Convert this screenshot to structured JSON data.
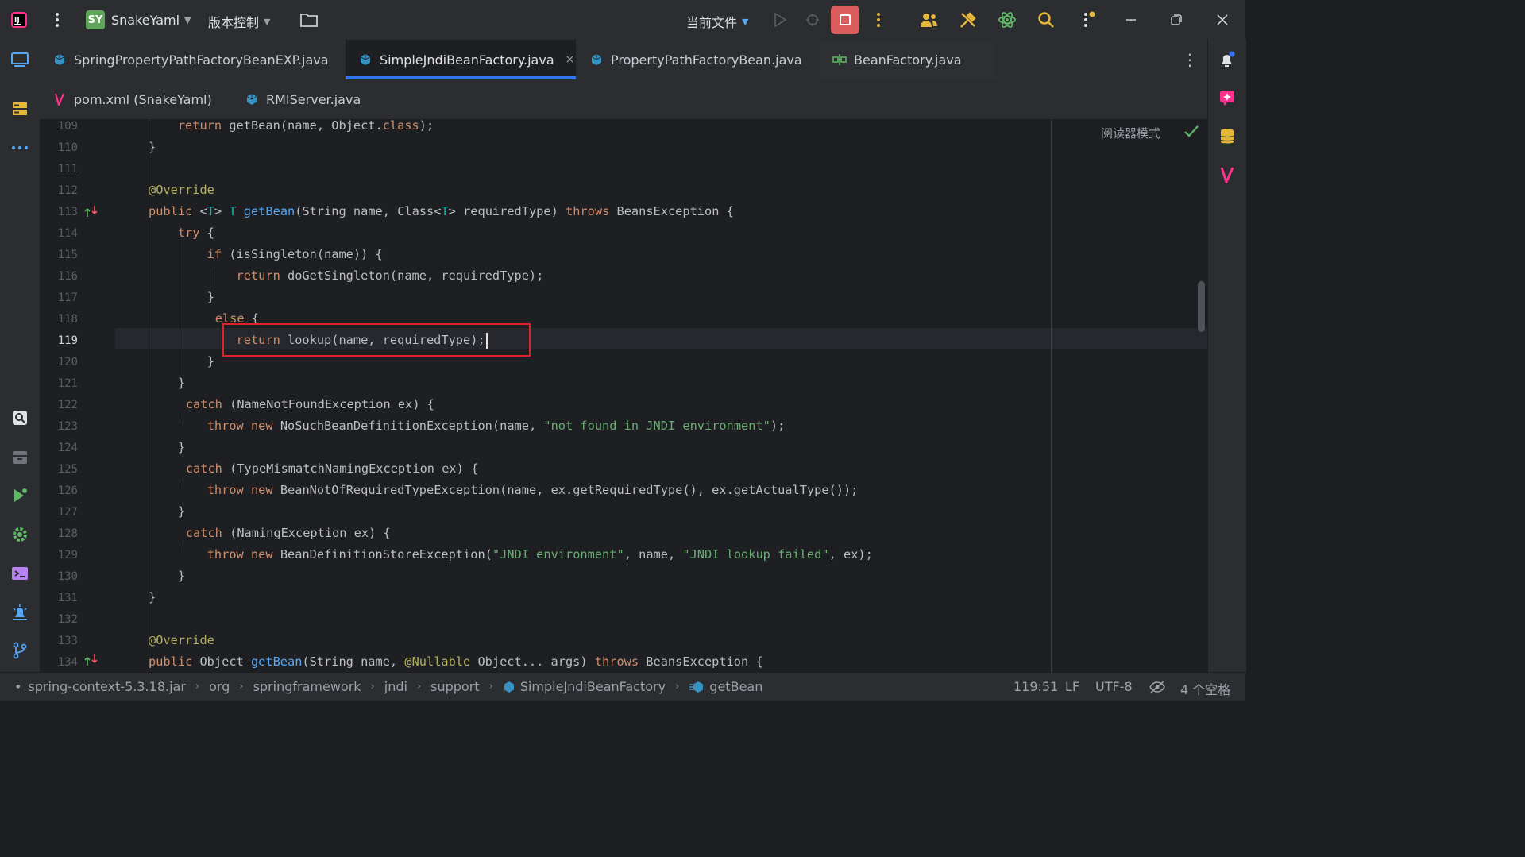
{
  "titlebar": {
    "project_badge": "SY",
    "project_name": "SnakeYaml",
    "vcs_label": "版本控制",
    "run_config": "当前文件",
    "icons": [
      "app-logo-icon",
      "main-menu-icon",
      "folder-icon",
      "run-icon",
      "debug-icon",
      "stop-icon",
      "more-actions-icon",
      "code-with-me-icon",
      "build-tools-icon",
      "ai-assistant-icon",
      "search-icon",
      "settings-updates-icon",
      "minimize-icon",
      "restore-icon",
      "close-icon"
    ]
  },
  "tabs_row1": [
    {
      "label": "SpringPropertyPathFactoryBeanEXP.java",
      "icon": "java-class-icon",
      "active": false
    },
    {
      "label": "SimpleJndiBeanFactory.java",
      "icon": "java-class-icon",
      "active": true
    },
    {
      "label": "PropertyPathFactoryBean.java",
      "icon": "java-class-icon",
      "active": false
    },
    {
      "label": "BeanFactory.java",
      "icon": "interface-icon",
      "active": false
    }
  ],
  "tabs_row2": [
    {
      "label": "pom.xml (SnakeYaml)",
      "icon": "maven-icon",
      "active": false
    },
    {
      "label": "RMIServer.java",
      "icon": "java-class-icon",
      "active": false
    }
  ],
  "tab_close_glyph": "×",
  "editor": {
    "reader_mode_label": "阅读器模式",
    "current_line": 119,
    "line_numbers": [
      "109",
      "110",
      "111",
      "112",
      "113",
      "114",
      "115",
      "116",
      "117",
      "118",
      "119",
      "120",
      "121",
      "122",
      "123",
      "124",
      "125",
      "126",
      "127",
      "128",
      "129",
      "130",
      "131",
      "132",
      "133",
      "134"
    ],
    "code": {
      "l109": {
        "kw1": "return",
        "rest": " getBean(name, Object.",
        "kw2": "class",
        "end": ");"
      },
      "l110": {
        "text": "}"
      },
      "l112": {
        "ann": "@Override"
      },
      "l113": {
        "kw1": "public",
        "lt": " <",
        "tp1": "T",
        "gt": "> ",
        "tp2": "T",
        "sp": " ",
        "fn": "getBean",
        "args1": "(String name, Class<",
        "tp3": "T",
        "args2": "> requiredType) ",
        "kw2": "throws",
        "rest": " BeansException {"
      },
      "l114": {
        "kw": "try",
        "rest": " {"
      },
      "l115": {
        "kw": "if",
        "rest": " (isSingleton(name)) {"
      },
      "l116": {
        "kw": "return",
        "rest": " doGetSingleton(name, requiredType);"
      },
      "l117": {
        "text": "}"
      },
      "l118": {
        "kw": "else",
        "rest": " {"
      },
      "l119": {
        "kw": "return",
        "rest": " lookup(name, requiredType);"
      },
      "l120": {
        "text": "}"
      },
      "l121": {
        "text": "}"
      },
      "l122": {
        "kw": "catch",
        "rest": " (NameNotFoundException ex) {"
      },
      "l123": {
        "kw1": "throw",
        "sp": " ",
        "kw2": "new",
        "rest": " NoSuchBeanDefinitionException(name, ",
        "str": "\"not found in JNDI environment\"",
        "end": ");"
      },
      "l124": {
        "text": "}"
      },
      "l125": {
        "kw": "catch",
        "rest": " (TypeMismatchNamingException ex) {"
      },
      "l126": {
        "kw1": "throw",
        "sp": " ",
        "kw2": "new",
        "rest": " BeanNotOfRequiredTypeException(name, ex.getRequiredType(), ex.getActualType());"
      },
      "l127": {
        "text": "}"
      },
      "l128": {
        "kw": "catch",
        "rest": " (NamingException ex) {"
      },
      "l129": {
        "kw1": "throw",
        "sp": " ",
        "kw2": "new",
        "mid": " BeanDefinitionStoreException(",
        "str1": "\"JNDI environment\"",
        "mid2": ", name, ",
        "str2": "\"JNDI lookup failed\"",
        "end": ", ex);"
      },
      "l130": {
        "text": "}"
      },
      "l131": {
        "text": "}"
      },
      "l133": {
        "ann": "@Override"
      },
      "l134": {
        "kw1": "public",
        "rest1": " Object ",
        "fn": "getBean",
        "args1": "(String name, ",
        "ann": "@Nullable",
        "args2": " Object... args) ",
        "kw2": "throws",
        "rest": " BeansException {"
      }
    }
  },
  "statusbar": {
    "breadcrumbs": [
      "spring-context-5.3.18.jar",
      "org",
      "springframework",
      "jndi",
      "support",
      "SimpleJndiBeanFactory",
      "getBean"
    ],
    "breadcrumb_sep": "›",
    "position": "119:51",
    "line_separator": "LF",
    "encoding": "UTF-8",
    "indent": "4 个空格"
  },
  "colors": {
    "accent": "#3574f0",
    "stop": "#db5c5c",
    "keyword": "#cf8e6d",
    "function": "#56a8f5",
    "annotation": "#b3ae60",
    "string": "#6aab73",
    "type_param": "#16baac",
    "highlight_box": "#e0222a"
  }
}
